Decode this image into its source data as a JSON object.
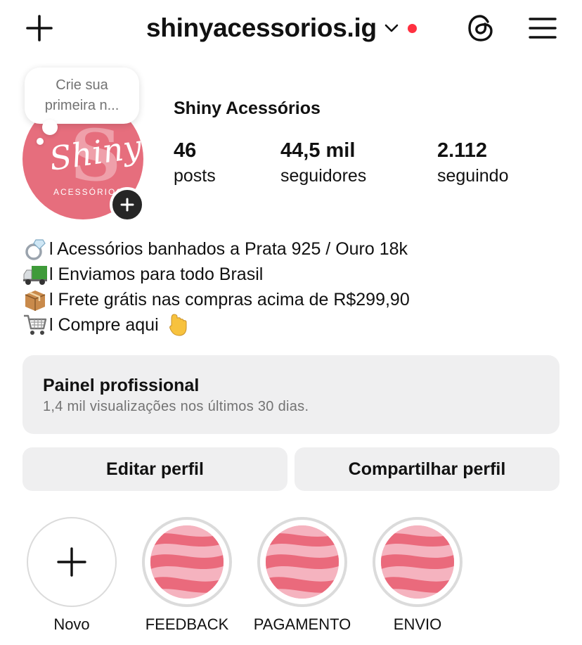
{
  "header": {
    "username": "shinyacessorios.ig",
    "icons": [
      "plus-icon",
      "chevron-down-icon",
      "notification-dot",
      "threads-icon",
      "menu-icon"
    ]
  },
  "note": {
    "line1": "Crie sua",
    "line2": "primeira n..."
  },
  "avatar": {
    "logo_letter": "S",
    "logo_script": "Shiny",
    "logo_sub": "ACESSÓRIOS"
  },
  "profile": {
    "name": "Shiny Acessórios",
    "stats": {
      "posts_count": "46",
      "posts_label": "posts",
      "followers_count": "44,5 mil",
      "followers_label": "seguidores",
      "following_count": "2.112",
      "following_label": "seguindo"
    }
  },
  "bio": {
    "lines": [
      {
        "emoji": "💍",
        "text": "l Acessórios banhados a Prata 925 / Ouro 18k"
      },
      {
        "emoji": "🚛",
        "text": "l Enviamos para todo Brasil"
      },
      {
        "emoji": "📦",
        "text": "l Frete grátis nas compras acima de R$299,90"
      },
      {
        "emoji": "🛒",
        "text": "l Compre aqui",
        "trailing_emoji": "👇"
      }
    ]
  },
  "dashboard": {
    "title": "Painel profissional",
    "subtitle": "1,4 mil visualizações nos últimos 30 dias."
  },
  "actions": {
    "edit": "Editar perfil",
    "share": "Compartilhar perfil"
  },
  "highlights": [
    {
      "label": "Novo"
    },
    {
      "label": "FEEDBACK"
    },
    {
      "label": "PAGAMENTO"
    },
    {
      "label": "ENVIO"
    }
  ],
  "colors": {
    "brand_pink": "#e66e7d",
    "notification_red": "#ff3040",
    "button_bg": "#efeff0",
    "muted_text": "#737373"
  }
}
